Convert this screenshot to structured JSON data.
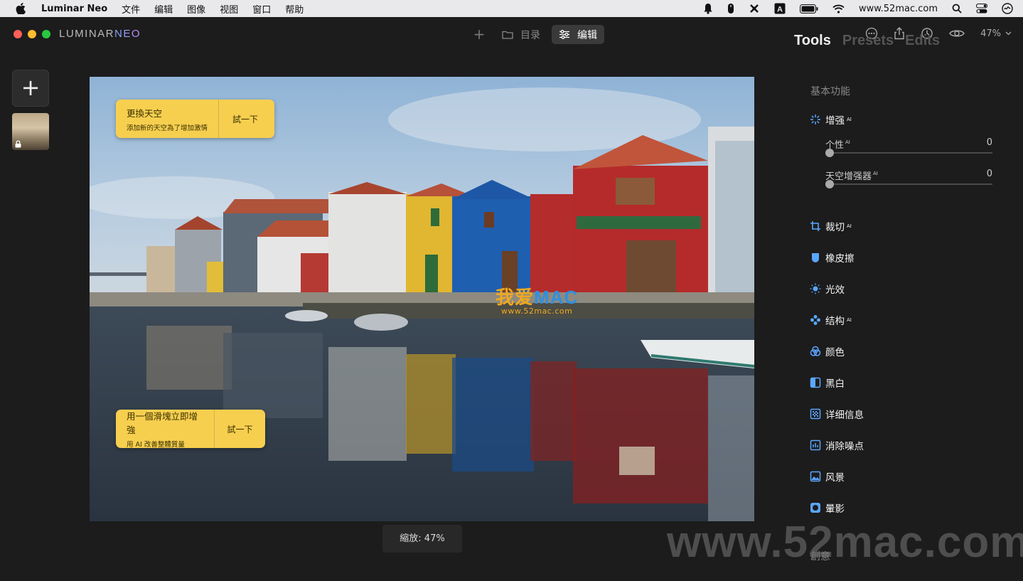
{
  "menubar": {
    "app_name": "Luminar Neo",
    "items": [
      "文件",
      "编辑",
      "图像",
      "视图",
      "窗口",
      "帮助"
    ],
    "url": "www.52mac.com"
  },
  "titlebar": {
    "logo_a": "LUMINAR",
    "logo_b": "NEO",
    "catalog_label": "目录",
    "edit_label": "编辑",
    "zoom_label": "47%"
  },
  "photo": {
    "promo1": {
      "title": "更換天空",
      "subtitle": "添加新的天空為了增加激情",
      "action": "試一下"
    },
    "promo2": {
      "title": "用一個滑塊立即增強",
      "subtitle": "用 AI 改善整體質量",
      "action": "試一下"
    },
    "watermark_a": "我爱",
    "watermark_mac": "MAC",
    "watermark_b": "www.52mac.com"
  },
  "zoom_box": "縮放: 47%",
  "panel": {
    "tabs": [
      "Tools",
      "Presets",
      "Edits"
    ],
    "section_basic": "基本功能",
    "enhance": {
      "label": "增强",
      "ai": "AI"
    },
    "sliders": [
      {
        "label": "个性",
        "ai": "AI",
        "value": "0",
        "level": 0
      },
      {
        "label": "天空增强器",
        "ai": "AI",
        "value": "0",
        "level": 0
      }
    ],
    "tools": [
      {
        "label": "裁切",
        "ai": "AI"
      },
      {
        "label": "橡皮擦",
        "ai": ""
      },
      {
        "label": "光效",
        "ai": ""
      },
      {
        "label": "结构",
        "ai": "AI"
      },
      {
        "label": "颜色",
        "ai": ""
      },
      {
        "label": "黑白",
        "ai": ""
      },
      {
        "label": "详细信息",
        "ai": ""
      },
      {
        "label": "消除噪点",
        "ai": ""
      },
      {
        "label": "风景",
        "ai": ""
      },
      {
        "label": "暈影",
        "ai": ""
      }
    ],
    "section_creative": "創意"
  },
  "bottom_watermark": "www.52mac.com",
  "colors": {
    "accent": "#f7cf4f",
    "tool_icon": "#5aa6ff"
  }
}
